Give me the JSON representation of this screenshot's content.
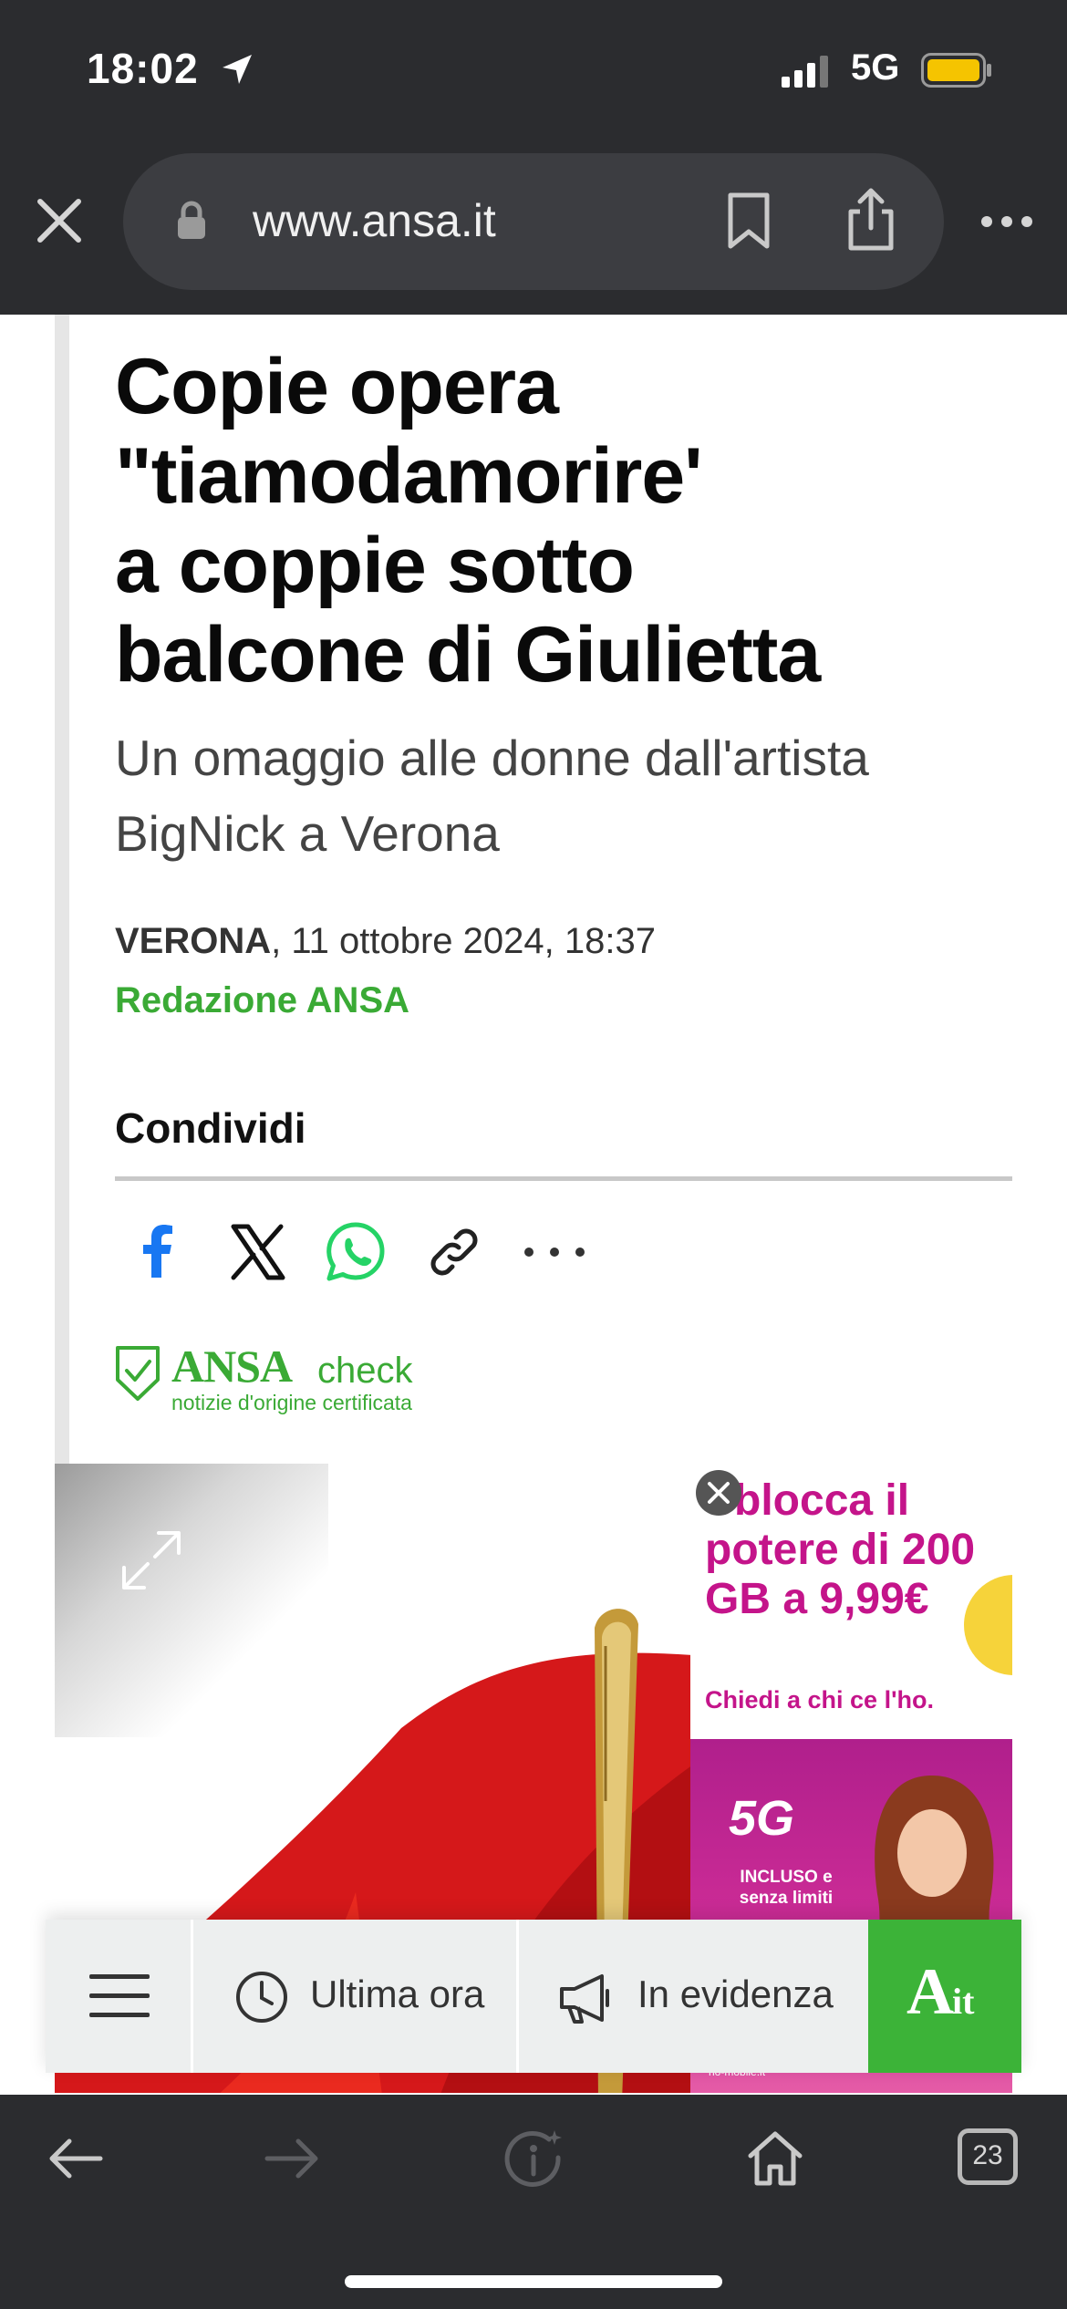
{
  "status_bar": {
    "time": "18:02",
    "network": "5G",
    "battery_color": "#f5c400"
  },
  "browser": {
    "url": "www.ansa.it",
    "tab_count": "23"
  },
  "article": {
    "headline_lines": [
      "Copie opera",
      "\"tiamodamorire'",
      "a coppie sotto",
      "balcone di Giulietta"
    ],
    "subtitle": "Un omaggio alle donne dall'artista BigNick a Verona",
    "dateline_city": "VERONA",
    "dateline_rest": ", 11 ottobre 2024, 18:37",
    "author": "Redazione ANSA",
    "share_heading": "Condividi",
    "share_icons": [
      "facebook-icon",
      "x-icon",
      "whatsapp-icon",
      "link-icon",
      "more-icon"
    ]
  },
  "ansacheck": {
    "brand": "ANSA",
    "check": "check",
    "tagline": "notizie d'origine certificata"
  },
  "ad": {
    "title": "Sblocca il potere di 200 GB a 9,99€",
    "subtitle": "Chiedi a chi ce l'ho.",
    "badge": "5G",
    "included": "INCLUSO e senza limiti",
    "footer": "ho-mobile.it"
  },
  "page_nav": {
    "ultima_ora": "Ultima ora",
    "in_evidenza": "In evidenza",
    "logo_a": "A",
    "logo_it": "it"
  },
  "colors": {
    "ansa_green": "#3aaa35",
    "ad_magenta": "#c4148a",
    "chrome_dark": "#2b2c2f"
  }
}
